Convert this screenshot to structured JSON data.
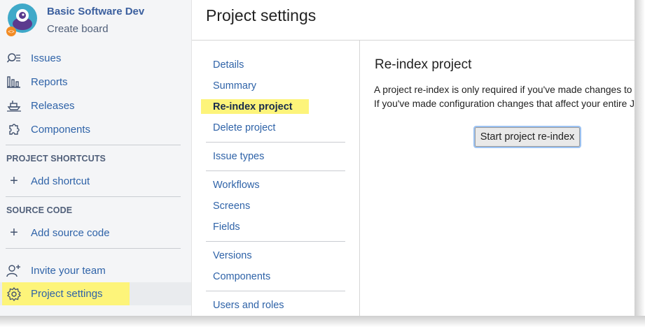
{
  "project": {
    "name": "Basic Software Dev",
    "subtitle": "Create board"
  },
  "sidebar": {
    "nav": [
      {
        "label": "Issues",
        "icon": "issues-icon"
      },
      {
        "label": "Reports",
        "icon": "reports-icon"
      },
      {
        "label": "Releases",
        "icon": "releases-icon"
      },
      {
        "label": "Components",
        "icon": "components-icon"
      }
    ],
    "shortcuts_heading": "PROJECT SHORTCUTS",
    "add_shortcut": "Add shortcut",
    "source_heading": "SOURCE CODE",
    "add_source": "Add source code",
    "invite": "Invite your team",
    "settings": "Project settings"
  },
  "header": {
    "title": "Project settings"
  },
  "settings_menu": {
    "items": [
      "Details",
      "Summary",
      "Re-index project",
      "Delete project",
      "Issue types",
      "Workflows",
      "Screens",
      "Fields",
      "Versions",
      "Components",
      "Users and roles"
    ],
    "active": "Re-index project"
  },
  "main": {
    "title": "Re-index project",
    "line1": "A project re-index is only required if you've made changes to",
    "line2": "If you've made configuration changes that affect your entire J",
    "button": "Start project re-index"
  },
  "colors": {
    "link": "#2f63a8",
    "highlight": "#fdf47a",
    "avatar_bg": "#3fa9c9",
    "badge": "#f28b24"
  }
}
